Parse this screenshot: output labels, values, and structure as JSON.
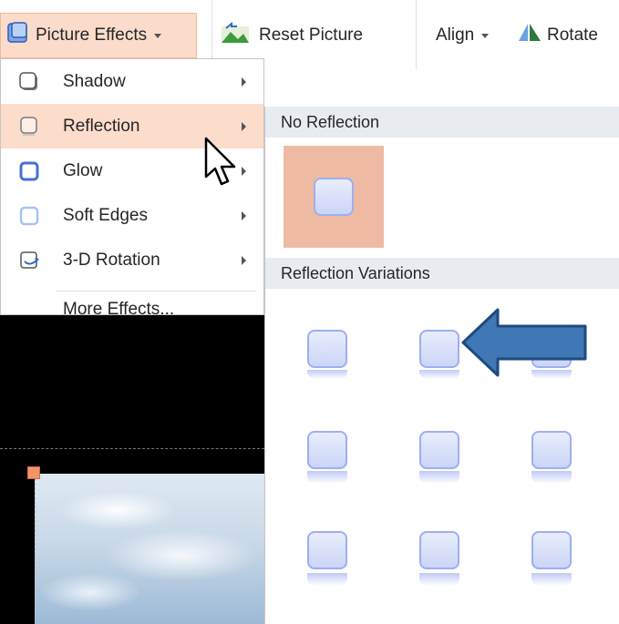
{
  "ribbon": {
    "picture_effects": "Picture Effects",
    "reset_picture": "Reset Picture",
    "align": "Align",
    "rotate": "Rotate"
  },
  "effects_menu": {
    "items": [
      {
        "label": "Shadow",
        "icon": "shadow-icon",
        "has_submenu": true
      },
      {
        "label": "Reflection",
        "icon": "reflection-icon",
        "has_submenu": true,
        "active": true
      },
      {
        "label": "Glow",
        "icon": "glow-icon",
        "has_submenu": true
      },
      {
        "label": "Soft Edges",
        "icon": "soft-edges-icon",
        "has_submenu": true
      },
      {
        "label": "3-D Rotation",
        "icon": "3d-rotation-icon",
        "has_submenu": true
      }
    ],
    "more_effects": "More Effects..."
  },
  "reflection_gallery": {
    "no_reflection_header": "No Reflection",
    "variations_header": "Reflection Variations",
    "selected": "No Reflection",
    "rows": 3,
    "columns": 3
  },
  "colors": {
    "accent": "#fcdccb",
    "selected_tile": "#eebaa4",
    "thumb_border": "#9cb0ee",
    "annotation_arrow": "#3f78b4"
  }
}
